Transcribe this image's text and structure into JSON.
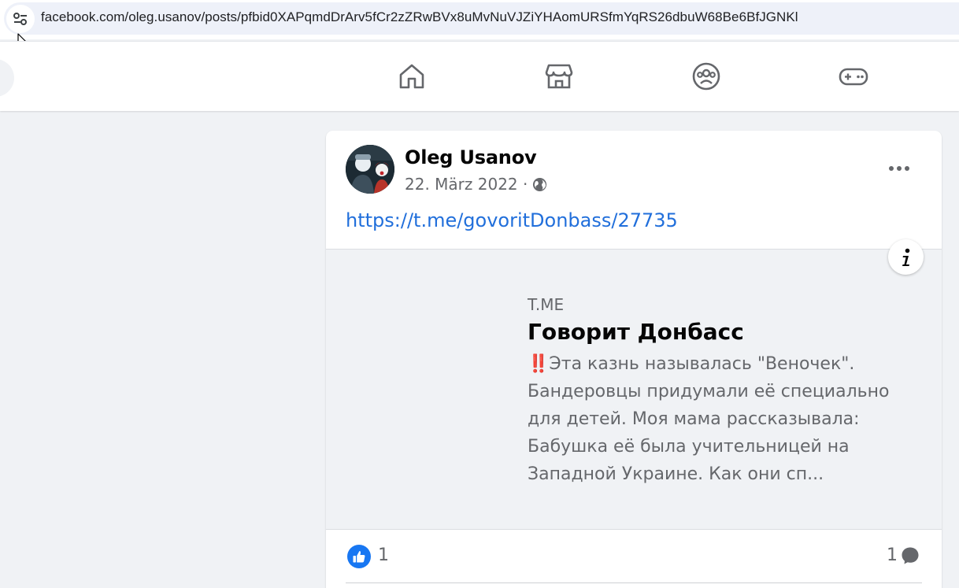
{
  "browser": {
    "url": "facebook.com/oleg.usanov/posts/pfbid0XAPqmdDrArv5fCr2zZRwBVx8uMvNuVJZiYHAomURSfmYqRS26dbuW68Be6BfJGNKl",
    "site_settings_icon": "tune-icon"
  },
  "nav": {
    "icons": [
      "home-icon",
      "marketplace-icon",
      "groups-icon",
      "gaming-icon"
    ]
  },
  "post": {
    "author": "Oleg Usanov",
    "date": "22. März 2022 ·",
    "privacy_icon": "globe-icon",
    "link": "https://t.me/govoritDonbass/27735",
    "preview": {
      "domain": "T.ME",
      "title": "Говорит Донбасс",
      "description_lines": [
        "‼️Эта казнь называлась \"Веночек\".",
        "Бандеровцы придумали её специально",
        "для детей. Моя мама рассказывала:",
        "Бабушка её была учительницей на",
        "Западной Украине. Как они сп..."
      ]
    },
    "likes": "1",
    "comments": "1"
  },
  "colors": {
    "link": "#216fdb",
    "like": "#1877f2",
    "background": "#f0f2f5"
  }
}
